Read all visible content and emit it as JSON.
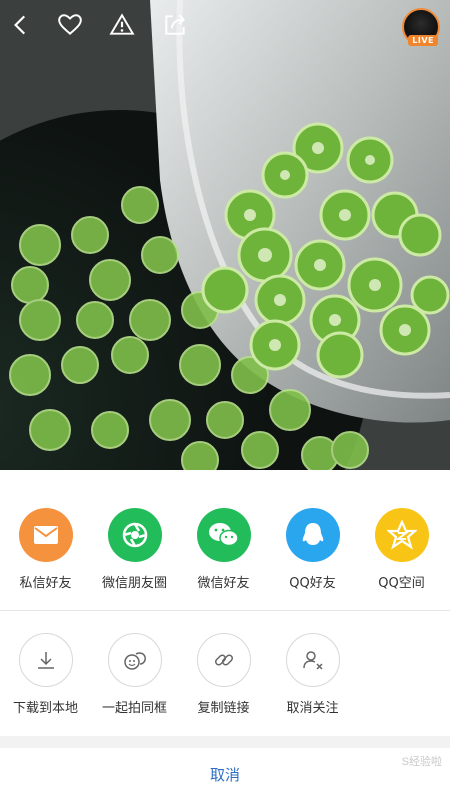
{
  "topbar": {
    "icons": [
      "back-icon",
      "heart-icon",
      "warning-icon",
      "share-icon"
    ],
    "live_badge": "LIVE"
  },
  "share_row": [
    {
      "label": "私信好友",
      "icon": "message-icon",
      "color": "#f5923e"
    },
    {
      "label": "微信朋友圈",
      "icon": "moments-icon",
      "color": "#22bd5a"
    },
    {
      "label": "微信好友",
      "icon": "wechat-icon",
      "color": "#22bd5a"
    },
    {
      "label": "QQ好友",
      "icon": "qq-icon",
      "color": "#2aa6ef"
    },
    {
      "label": "QQ空间",
      "icon": "qzone-icon",
      "color": "#f8c516"
    }
  ],
  "action_row": [
    {
      "label": "下载到本地",
      "icon": "download-icon"
    },
    {
      "label": "一起拍同框",
      "icon": "duet-icon"
    },
    {
      "label": "复制链接",
      "icon": "link-icon"
    },
    {
      "label": "取消关注",
      "icon": "unfollow-icon"
    }
  ],
  "cancel_label": "取消",
  "watermark": "S经验啦"
}
